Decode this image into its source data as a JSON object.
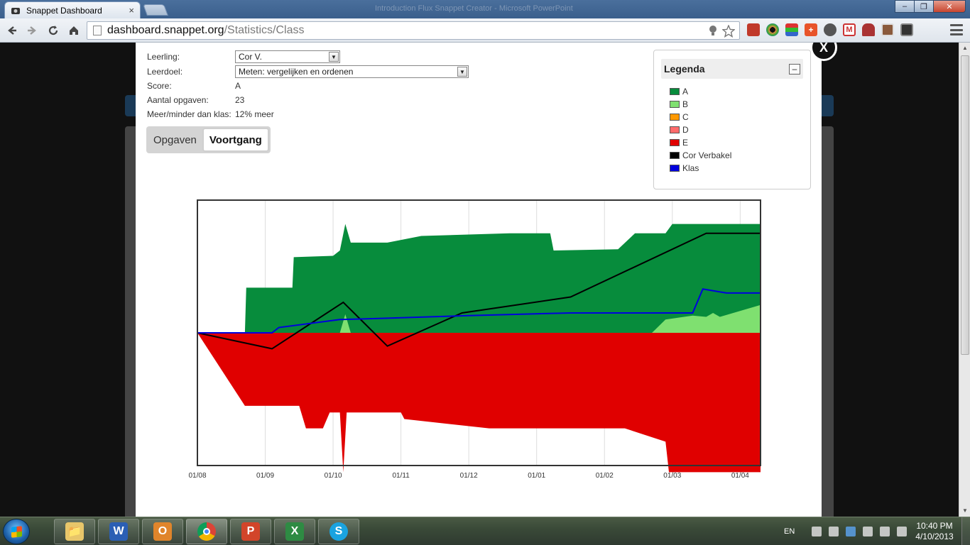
{
  "browser": {
    "tab_title": "Snappet Dashboard",
    "tab_close": "×",
    "window_title": "Introduction Flux Snappet Creator - Microsoft PowerPoint",
    "url_host": "dashboard.snappet.org",
    "url_path": "/Statistics/Class",
    "win_min": "–",
    "win_max": "❐",
    "win_close": "✕"
  },
  "student_info": {
    "leerling_label": "Leerling:",
    "leerling_value": "Cor V.",
    "leerdoel_label": "Leerdoel:",
    "leerdoel_value": "Meten: vergelijken en ordenen",
    "score_label": "Score:",
    "score_value": "A",
    "opgaven_label": "Aantal opgaven:",
    "opgaven_value": "23",
    "klas_label": "Meer/minder dan klas:",
    "klas_value": "12% meer"
  },
  "tabs": [
    {
      "label": "Opgaven",
      "active": false
    },
    {
      "label": "Voortgang",
      "active": true
    }
  ],
  "legend": {
    "title": "Legenda",
    "collapse_label": "–",
    "items": [
      {
        "label": "A",
        "color": "#078c3c"
      },
      {
        "label": "B",
        "color": "#7fe070"
      },
      {
        "label": "C",
        "color": "#ff9900"
      },
      {
        "label": "D",
        "color": "#ff6b6b"
      },
      {
        "label": "E",
        "color": "#e00000"
      },
      {
        "label": "Cor Verbakel",
        "color": "#000000"
      },
      {
        "label": "Klas",
        "color": "#0000dd"
      }
    ]
  },
  "modal_close": "X",
  "chart_data": {
    "type": "area",
    "x_tick_labels": [
      "01/08",
      "01/09",
      "01/10",
      "01/11",
      "01/12",
      "01/01",
      "01/02",
      "01/03",
      "01/04"
    ],
    "x_range": [
      0,
      8.3
    ],
    "y_range": [
      -1,
      1
    ],
    "series": [
      {
        "name": "A",
        "type": "area",
        "color": "#078c3c",
        "points": [
          [
            0,
            0
          ],
          [
            0.7,
            0
          ],
          [
            0.72,
            0.34
          ],
          [
            1.4,
            0.34
          ],
          [
            1.42,
            0.57
          ],
          [
            2.0,
            0.58
          ],
          [
            2.1,
            0.62
          ],
          [
            2.18,
            0.82
          ],
          [
            2.26,
            0.68
          ],
          [
            2.8,
            0.68
          ],
          [
            3.3,
            0.73
          ],
          [
            4.6,
            0.75
          ],
          [
            5.2,
            0.75
          ],
          [
            5.25,
            0.62
          ],
          [
            6.2,
            0.63
          ],
          [
            6.45,
            0.75
          ],
          [
            6.9,
            0.75
          ],
          [
            7.0,
            0.82
          ],
          [
            8.3,
            0.82
          ]
        ]
      },
      {
        "name": "B",
        "type": "area",
        "color": "#7fe070",
        "points": [
          [
            0,
            0
          ],
          [
            2.1,
            0
          ],
          [
            2.18,
            0.14
          ],
          [
            2.26,
            0
          ],
          [
            6.7,
            0
          ],
          [
            6.9,
            0.1
          ],
          [
            7.3,
            0.13
          ],
          [
            7.5,
            0.12
          ],
          [
            7.6,
            0.15
          ],
          [
            7.7,
            0.12
          ],
          [
            8.3,
            0.21
          ]
        ]
      },
      {
        "name": "C",
        "type": "area",
        "color": "#ff9900",
        "points": [
          [
            0,
            0
          ],
          [
            7.8,
            0
          ],
          [
            8.3,
            -0.02
          ]
        ]
      },
      {
        "name": "D",
        "type": "area",
        "color": "#ff6b6b",
        "points": [
          [
            0,
            0
          ],
          [
            1.4,
            -0.06
          ],
          [
            2.1,
            -0.06
          ],
          [
            2.18,
            -0.25
          ],
          [
            2.26,
            -0.06
          ],
          [
            6.7,
            -0.06
          ],
          [
            6.9,
            -0.15
          ],
          [
            7.3,
            -0.17
          ],
          [
            8.3,
            -0.27
          ]
        ]
      },
      {
        "name": "E",
        "type": "area",
        "color": "#e00000",
        "points": [
          [
            0,
            0
          ],
          [
            0.7,
            -0.55
          ],
          [
            1.5,
            -0.55
          ],
          [
            1.6,
            -0.72
          ],
          [
            1.85,
            -0.72
          ],
          [
            1.95,
            -0.6
          ],
          [
            2.1,
            -0.6
          ],
          [
            2.15,
            -1.05
          ],
          [
            2.2,
            -0.6
          ],
          [
            3.0,
            -0.6
          ],
          [
            3.05,
            -0.65
          ],
          [
            4.3,
            -0.72
          ],
          [
            6.3,
            -0.72
          ],
          [
            6.9,
            -0.82
          ],
          [
            6.95,
            -1.05
          ],
          [
            8.3,
            -1.05
          ]
        ]
      },
      {
        "name": "Cor Verbakel",
        "type": "line",
        "color": "#000000",
        "points": [
          [
            0,
            0
          ],
          [
            1.1,
            -0.12
          ],
          [
            2.15,
            0.23
          ],
          [
            2.8,
            -0.1
          ],
          [
            3.9,
            0.15
          ],
          [
            5.5,
            0.27
          ],
          [
            7.5,
            0.75
          ],
          [
            8.3,
            0.75
          ]
        ]
      },
      {
        "name": "Klas",
        "type": "line",
        "color": "#0000dd",
        "points": [
          [
            0,
            0
          ],
          [
            1.1,
            0
          ],
          [
            1.2,
            0.04
          ],
          [
            2.1,
            0.1
          ],
          [
            2.8,
            0.11
          ],
          [
            4.0,
            0.13
          ],
          [
            5.5,
            0.15
          ],
          [
            6.5,
            0.15
          ],
          [
            7.3,
            0.15
          ],
          [
            7.45,
            0.33
          ],
          [
            7.8,
            0.3
          ],
          [
            8.3,
            0.3
          ]
        ]
      }
    ]
  },
  "taskbar": {
    "apps": [
      {
        "name": "explorer",
        "glyph": "📁",
        "color": "#e8c66a"
      },
      {
        "name": "word",
        "glyph": "W",
        "color": "#2b5fb4"
      },
      {
        "name": "outlook",
        "glyph": "O",
        "color": "#e0852b"
      },
      {
        "name": "chrome",
        "glyph": "",
        "color": "#3c9c3c"
      },
      {
        "name": "powerpoint",
        "glyph": "P",
        "color": "#d2452a"
      },
      {
        "name": "excel",
        "glyph": "X",
        "color": "#2e8b43"
      },
      {
        "name": "skype",
        "glyph": "S",
        "color": "#1aa3e0"
      }
    ],
    "language": "EN",
    "time": "10:40 PM",
    "date": "4/10/2013"
  }
}
